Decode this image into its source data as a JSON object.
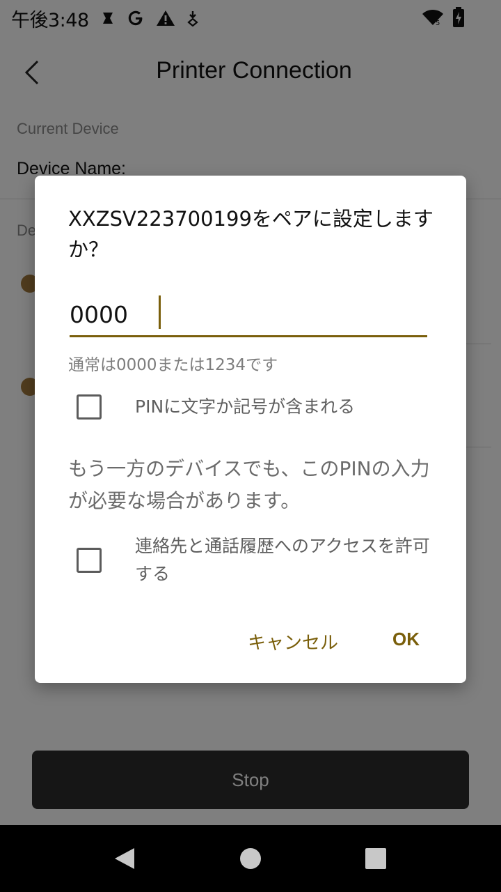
{
  "status_bar": {
    "time": "午後3:48",
    "left_icons": [
      "notification-icon",
      "google-icon",
      "warning-icon",
      "download-icon"
    ],
    "right_icons": [
      "wifi-icon",
      "battery-charging-icon"
    ]
  },
  "header": {
    "title": "Printer Connection"
  },
  "current_device": {
    "section_label": "Current Device",
    "device_name_label": "Device Name:"
  },
  "devices": {
    "section_label_partial": "De"
  },
  "stop_button": {
    "label": "Stop"
  },
  "dialog": {
    "title": "XXZSV223700199をペアに設定しますか？",
    "pin_value": "0000",
    "pin_hint": "通常は0000または1234です",
    "pin_chars_checkbox": {
      "label": "PINに文字か記号が含まれる",
      "checked": false
    },
    "pin_note": "もう一方のデバイスでも、このPINの入力が必要な場合があります。",
    "contacts_checkbox": {
      "label": "連絡先と通話履歴へのアクセスを許可する",
      "checked": false
    },
    "cancel_label": "キャンセル",
    "ok_label": "OK"
  },
  "colors": {
    "accent": "#7a5f0b",
    "scrim": "#000000",
    "stop_button_bg": "#2c2c2c"
  },
  "nav_bar": {
    "icons": [
      "nav-back-icon",
      "nav-home-icon",
      "nav-recents-icon"
    ]
  }
}
